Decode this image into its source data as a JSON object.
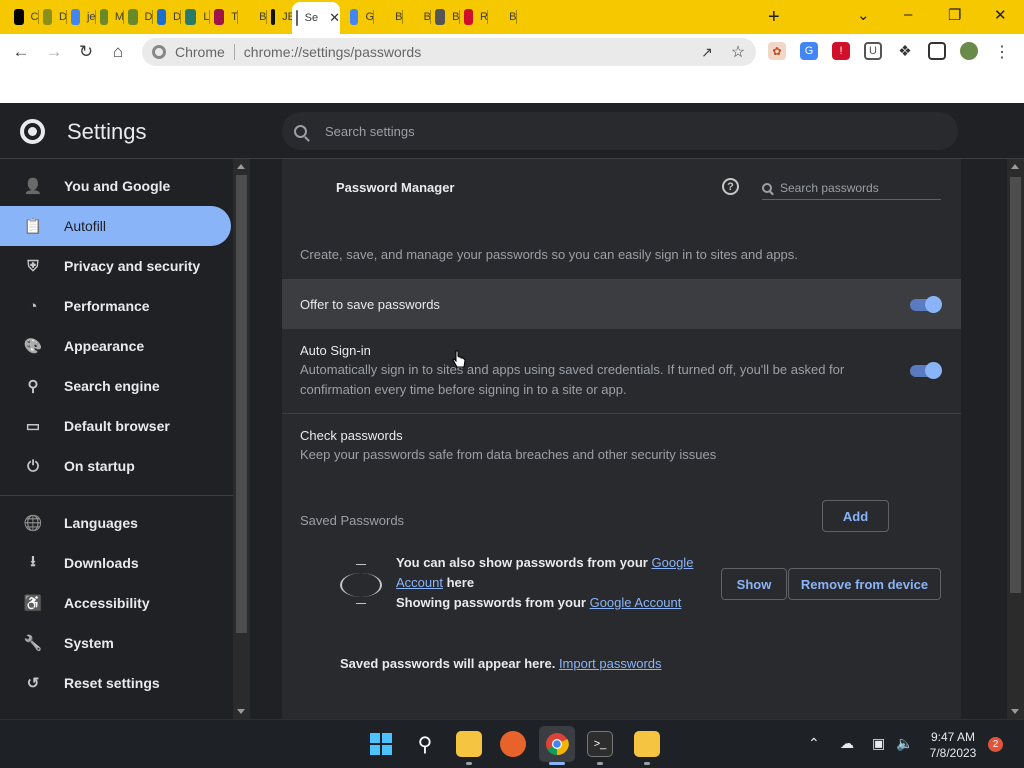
{
  "tabs": [
    {
      "letter": "C",
      "color": "#000000"
    },
    {
      "letter": "D",
      "color": "#8a8f1e"
    },
    {
      "letter": "je",
      "color": "#4285f4"
    },
    {
      "letter": "M",
      "color": "#6a8a2a"
    },
    {
      "letter": "D",
      "color": "#6a8a2a"
    },
    {
      "letter": "D",
      "color": "#1a6fd1"
    },
    {
      "letter": "L",
      "color": "#2a7a6a"
    },
    {
      "letter": "T",
      "color": "#a0144a"
    },
    {
      "letter": "B",
      "color": "#f6c800"
    },
    {
      "letter": "JE",
      "color": "#111111"
    },
    {
      "letter": "Se",
      "color": "#5f6368"
    },
    {
      "letter": "G",
      "color": "#4285f4"
    },
    {
      "letter": "B",
      "color": "#f6c800"
    },
    {
      "letter": "B",
      "color": "#f6c800"
    },
    {
      "letter": "B",
      "color": "#555555"
    },
    {
      "letter": "R",
      "color": "#d0102a"
    },
    {
      "letter": "B",
      "color": "#f6c800"
    }
  ],
  "toolbar": {
    "origin": "Chrome",
    "url": "chrome://settings/passwords"
  },
  "settings": {
    "title": "Settings",
    "search_placeholder": "Search settings"
  },
  "sidebar": {
    "items": [
      {
        "label": "You and Google",
        "icon": "person-icon"
      },
      {
        "label": "Autofill",
        "icon": "clipboard-icon",
        "selected": true
      },
      {
        "label": "Privacy and security",
        "icon": "shield-icon"
      },
      {
        "label": "Performance",
        "icon": "speedometer-icon"
      },
      {
        "label": "Appearance",
        "icon": "palette-icon"
      },
      {
        "label": "Search engine",
        "icon": "search-icon"
      },
      {
        "label": "Default browser",
        "icon": "browser-icon"
      },
      {
        "label": "On startup",
        "icon": "power-icon"
      },
      {
        "label": "Languages",
        "icon": "globe-icon"
      },
      {
        "label": "Downloads",
        "icon": "download-icon"
      },
      {
        "label": "Accessibility",
        "icon": "accessibility-icon"
      },
      {
        "label": "System",
        "icon": "wrench-icon"
      },
      {
        "label": "Reset settings",
        "icon": "history-icon"
      }
    ]
  },
  "password_manager": {
    "title": "Password Manager",
    "search_placeholder": "Search passwords",
    "description": "Create, save, and manage your passwords so you can easily sign in to sites and apps.",
    "offer_to_save": {
      "label": "Offer to save passwords",
      "enabled": true
    },
    "auto_signin": {
      "label": "Auto Sign-in",
      "sub_line1": "Automatically sign in to sites and apps using saved credentials. If turned off, you'll be asked for",
      "sub_line2": "confirmation every time before signing in to a site or app.",
      "enabled": true
    },
    "check_passwords": {
      "label": "Check passwords",
      "sub": "Keep your passwords safe from data breaches and other security issues"
    },
    "saved": {
      "title": "Saved Passwords",
      "add_label": "Add",
      "show_from_prefix": "You can also show passwords from your",
      "google_word": "Google",
      "account_word": "Account",
      "here": "here",
      "showing_prefix": "Showing passwords from your",
      "google_account": "Google Account",
      "show_label": "Show",
      "remove_label": "Remove from device",
      "empty_text": "Saved passwords will appear here.",
      "import_label": "Import passwords"
    }
  },
  "taskbar": {
    "time": "9:47 AM",
    "date": "7/8/2023",
    "notifications": "2"
  },
  "colors": {
    "accent": "#8ab4f8",
    "tabstrip": "#f6c800",
    "background": "#202124",
    "card": "#292a2d"
  }
}
